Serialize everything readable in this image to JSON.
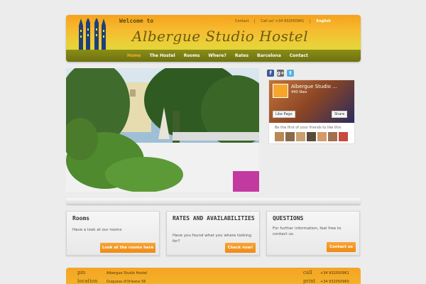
{
  "header": {
    "welcome": "Welcome to",
    "brand": "Albergue Studio Hostel",
    "contact_link": "Contact",
    "call_text": "Call us! +34 932050961",
    "language": "English",
    "nav": [
      "Home",
      "The Hostel",
      "Rooms",
      "Where?",
      "Rates",
      "Barcelona",
      "Contact"
    ]
  },
  "social": {
    "facebook_icon": "f",
    "googleplus_icon": "g+",
    "twitter_icon": "t",
    "fb_page_name": "Albergue Studio ...",
    "fb_likes": "440 likes",
    "like_button": "Like Page",
    "share_button": "Share",
    "friends_text": "Be the first of your friends to like this"
  },
  "boxes": [
    {
      "title": "Rooms",
      "text": "Have a look at our rooms",
      "button": "Look at the rooms here"
    },
    {
      "title": "RATES AND AVAILABILITIES",
      "text": "Have you found what you where looking for?",
      "button": "Check now!"
    },
    {
      "title": "QUESTIONS",
      "text": "For further information, feel free to contact us.",
      "button": "Contact us"
    }
  ],
  "footer": {
    "pin_label": "pin",
    "pin_value": "Albergue Studio Hostel",
    "location_label": "location",
    "location_value": "Duquesa d'Orleans 56",
    "call_label": "call",
    "call_value": "+34 932050961",
    "print_label": "print",
    "print_value": "+34 932050960"
  },
  "colors": {
    "accent": "#f9a533",
    "nav": "#7a7e12",
    "header": "#f5a21c"
  }
}
